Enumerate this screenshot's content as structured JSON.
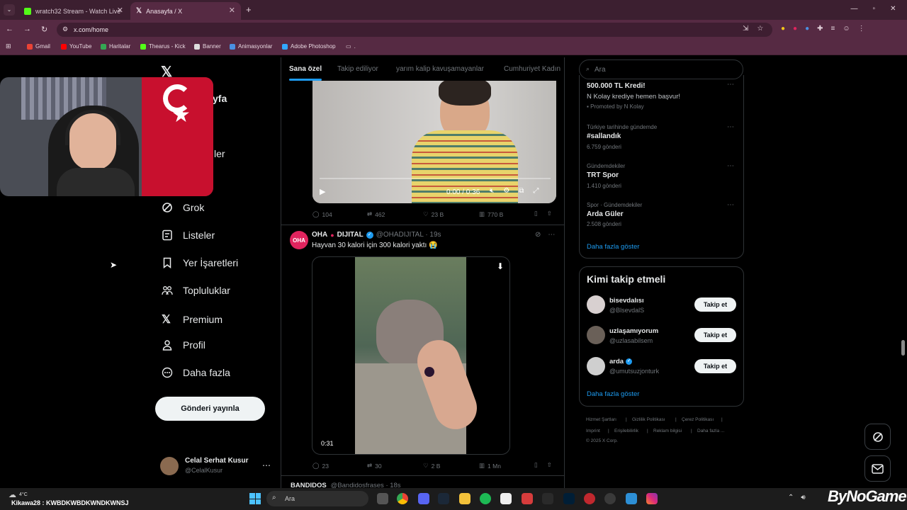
{
  "browser": {
    "tabs": [
      {
        "label": "wratch32 Stream - Watch Live o",
        "active": false
      },
      {
        "label": "Anasayfa / X",
        "active": true
      }
    ],
    "url": "x.com/home",
    "bookmarks": [
      "Gmail",
      "YouTube",
      "Haritalar",
      "Thearus - Kick",
      "Banner",
      "Animasyonlar",
      "Adobe Photoshop"
    ],
    "bookmark_folder": "."
  },
  "sidebar": {
    "partial_items": [
      "yfa",
      "ler"
    ],
    "items": [
      "Grok",
      "Listeler",
      "Yer İşaretleri",
      "Topluluklar",
      "Premium",
      "Profil",
      "Daha fazla"
    ],
    "post_button": "Gönderi yayınla",
    "account": {
      "name": "Celal Serhat Kusur",
      "handle": "@CelalKusur"
    }
  },
  "feed": {
    "tabs": [
      "Sana özel",
      "Takip ediliyor",
      "yarım kalip kavuşamayanlar",
      "Cumhuriyet Kadın"
    ],
    "video1": {
      "time": "0:00 / 0:36",
      "actions": [
        "104",
        "462",
        "23 B",
        "770 B"
      ]
    },
    "tweet2": {
      "name": "OHA",
      "name2": "DIJITAL",
      "avatar_text": "OHA",
      "handle_time": "@OHADIJITAL · 19s",
      "text": "Hayvan 30 kalori için 300 kalori yaktı 😭",
      "duration": "0:31",
      "actions": [
        "23",
        "30",
        "2 B",
        "1 Mn"
      ]
    },
    "tweet3": {
      "name": "BANDIDOS",
      "handle_time": "@Bandidosfrases · 18s"
    }
  },
  "right": {
    "search_placeholder": "Ara",
    "ad": {
      "title": "500.000 TL Kredi!",
      "body": "N Kolay krediye hemen başvur!",
      "promoted": "Promoted by N Kolay"
    },
    "trends": [
      {
        "cat": "Türkiye tarihinde gündemde",
        "title": "#sallandık",
        "count": "6.759 gönderi"
      },
      {
        "cat": "Gündemdekiler",
        "title": "TRT Spor",
        "count": "1.410 gönderi"
      },
      {
        "cat": "Spor · Gündemdekiler",
        "title": "Arda Güler",
        "count": "2.508 gönderi"
      }
    ],
    "show_more": "Daha fazla göster",
    "who_to_follow": {
      "title": "Kimi takip etmeli",
      "users": [
        {
          "name": "bisevdalısı",
          "handle": "@BlsevdalS",
          "button": "Takip et"
        },
        {
          "name": "uzlaşamıyorum",
          "handle": "@uzlasabilsem",
          "button": "Takip et"
        },
        {
          "name": "arda",
          "handle": "@umutsuzjonturk",
          "button": "Takip et"
        }
      ],
      "show_more": "Daha fazla göster"
    },
    "footer": [
      "Hizmet Şartları",
      "Gizlilik Politikası",
      "Çerez Politikası",
      "Imprint",
      "Erişilebilirlik",
      "Reklam bilgisi",
      "Daha fazla ...",
      "© 2025 X Corp."
    ]
  },
  "taskbar": {
    "weather": "4°C",
    "chat": "Kikawa28 : KWBDKWBDKWNDKWNSJ",
    "search": "Ara",
    "watermark": "ByNoGame"
  },
  "colors": {
    "accent": "#1d9bf0",
    "chrome_tab": "#3c1f30",
    "chrome_bar": "#562a43",
    "oha_red": "#e0245e"
  }
}
